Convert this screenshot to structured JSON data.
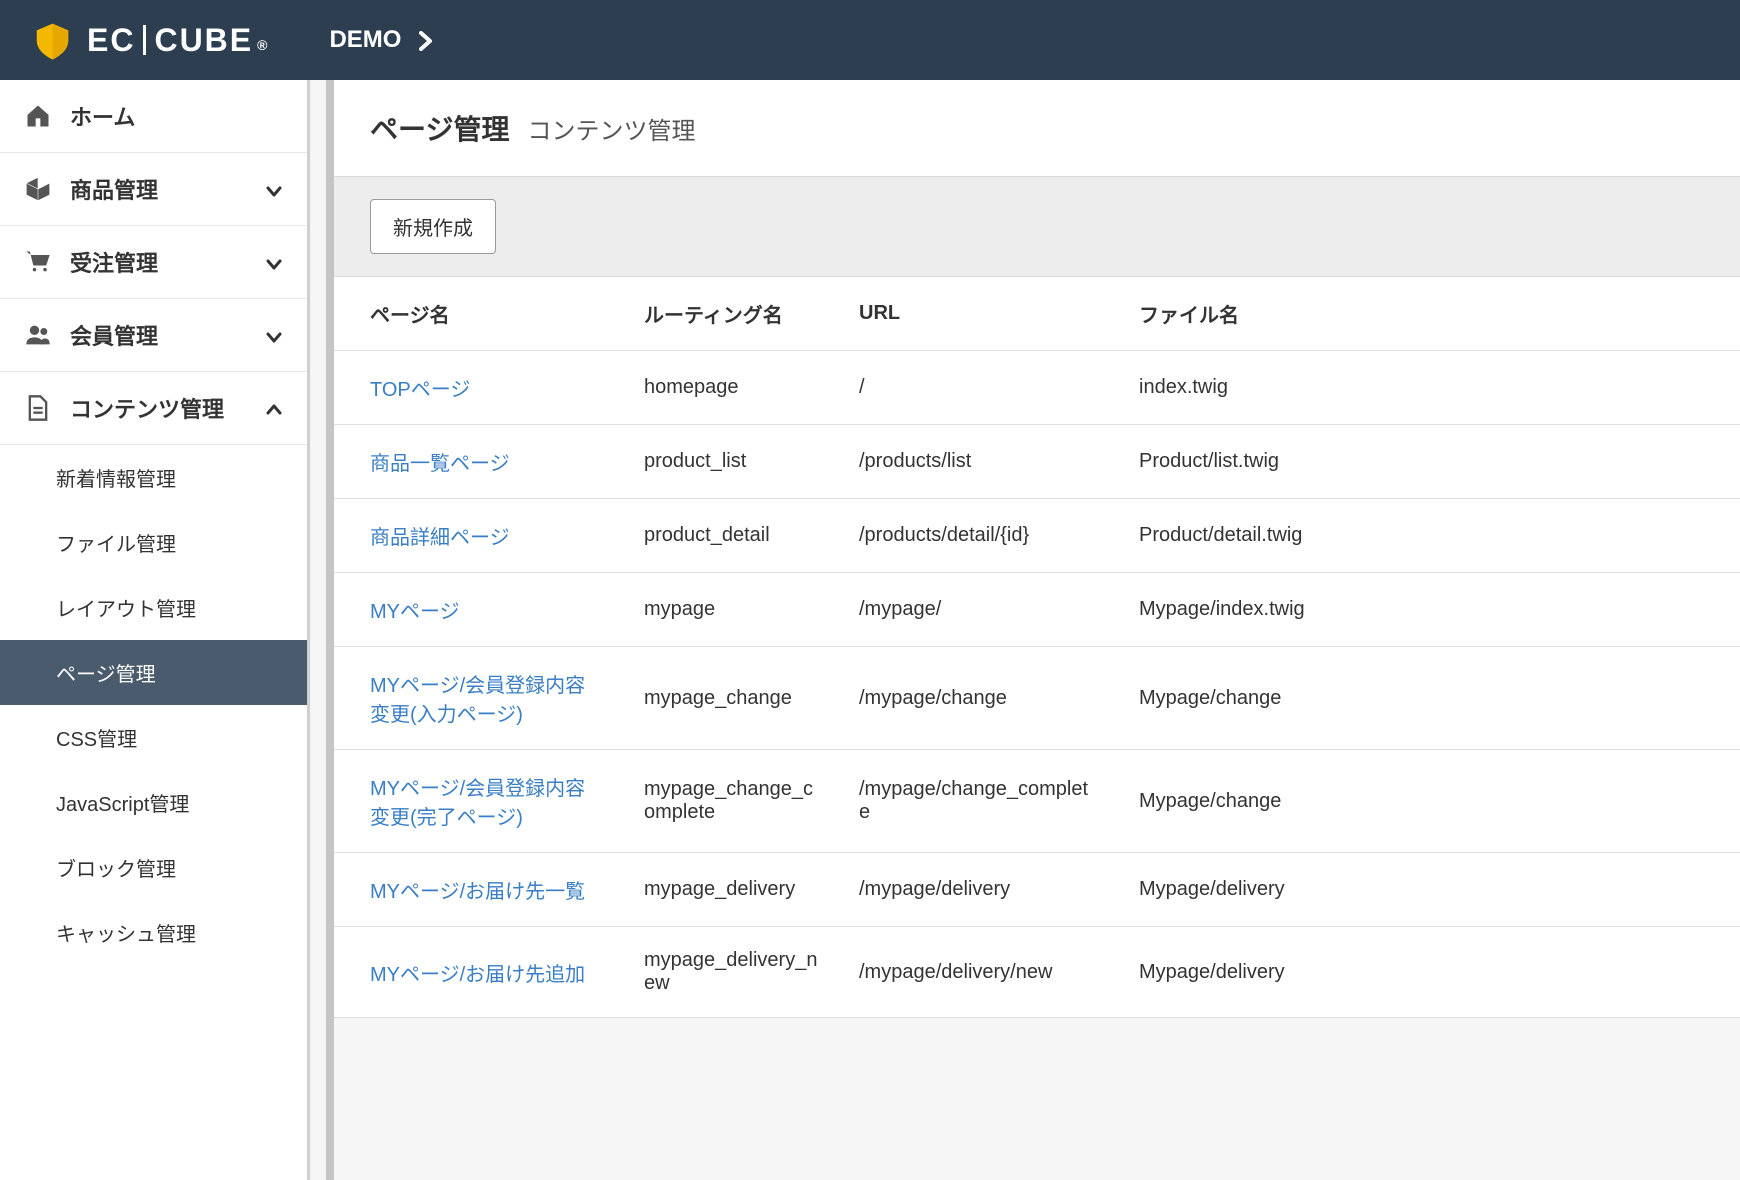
{
  "header": {
    "logo_ec": "EC",
    "logo_cube": "CUBE",
    "logo_dot": "®",
    "demo_label": "DEMO"
  },
  "sidebar": {
    "items": [
      {
        "icon": "home",
        "label": "ホーム",
        "expandable": false
      },
      {
        "icon": "cube",
        "label": "商品管理",
        "expandable": true
      },
      {
        "icon": "cart",
        "label": "受注管理",
        "expandable": true
      },
      {
        "icon": "users",
        "label": "会員管理",
        "expandable": true
      },
      {
        "icon": "file",
        "label": "コンテンツ管理",
        "expandable": true,
        "expanded": true
      }
    ],
    "subitems": [
      {
        "label": "新着情報管理",
        "active": false
      },
      {
        "label": "ファイル管理",
        "active": false
      },
      {
        "label": "レイアウト管理",
        "active": false
      },
      {
        "label": "ページ管理",
        "active": true
      },
      {
        "label": "CSS管理",
        "active": false
      },
      {
        "label": "JavaScript管理",
        "active": false
      },
      {
        "label": "ブロック管理",
        "active": false
      },
      {
        "label": "キャッシュ管理",
        "active": false
      }
    ]
  },
  "page": {
    "title": "ページ管理",
    "subtitle": "コンテンツ管理",
    "create_button": "新規作成"
  },
  "table": {
    "headers": {
      "page_name": "ページ名",
      "routing": "ルーティング名",
      "url": "URL",
      "file": "ファイル名"
    },
    "rows": [
      {
        "page": "TOPページ",
        "route": "homepage",
        "url": "/",
        "file": "index.twig"
      },
      {
        "page": "商品一覧ページ",
        "route": "product_list",
        "url": "/products/list",
        "file": "Product/list.twig"
      },
      {
        "page": "商品詳細ページ",
        "route": "product_detail",
        "url": "/products/detail/{id}",
        "file": "Product/detail.twig"
      },
      {
        "page": "MYページ",
        "route": "mypage",
        "url": "/mypage/",
        "file": "Mypage/index.twig"
      },
      {
        "page": "MYページ/会員登録内容変更(入力ページ)",
        "route": "mypage_change",
        "url": "/mypage/change",
        "file": "Mypage/change"
      },
      {
        "page": "MYページ/会員登録内容変更(完了ページ)",
        "route": "mypage_change_complete",
        "url": "/mypage/change_complete",
        "file": "Mypage/change"
      },
      {
        "page": "MYページ/お届け先一覧",
        "route": "mypage_delivery",
        "url": "/mypage/delivery",
        "file": "Mypage/delivery"
      },
      {
        "page": "MYページ/お届け先追加",
        "route": "mypage_delivery_new",
        "url": "/mypage/delivery/new",
        "file": "Mypage/delivery"
      }
    ]
  }
}
